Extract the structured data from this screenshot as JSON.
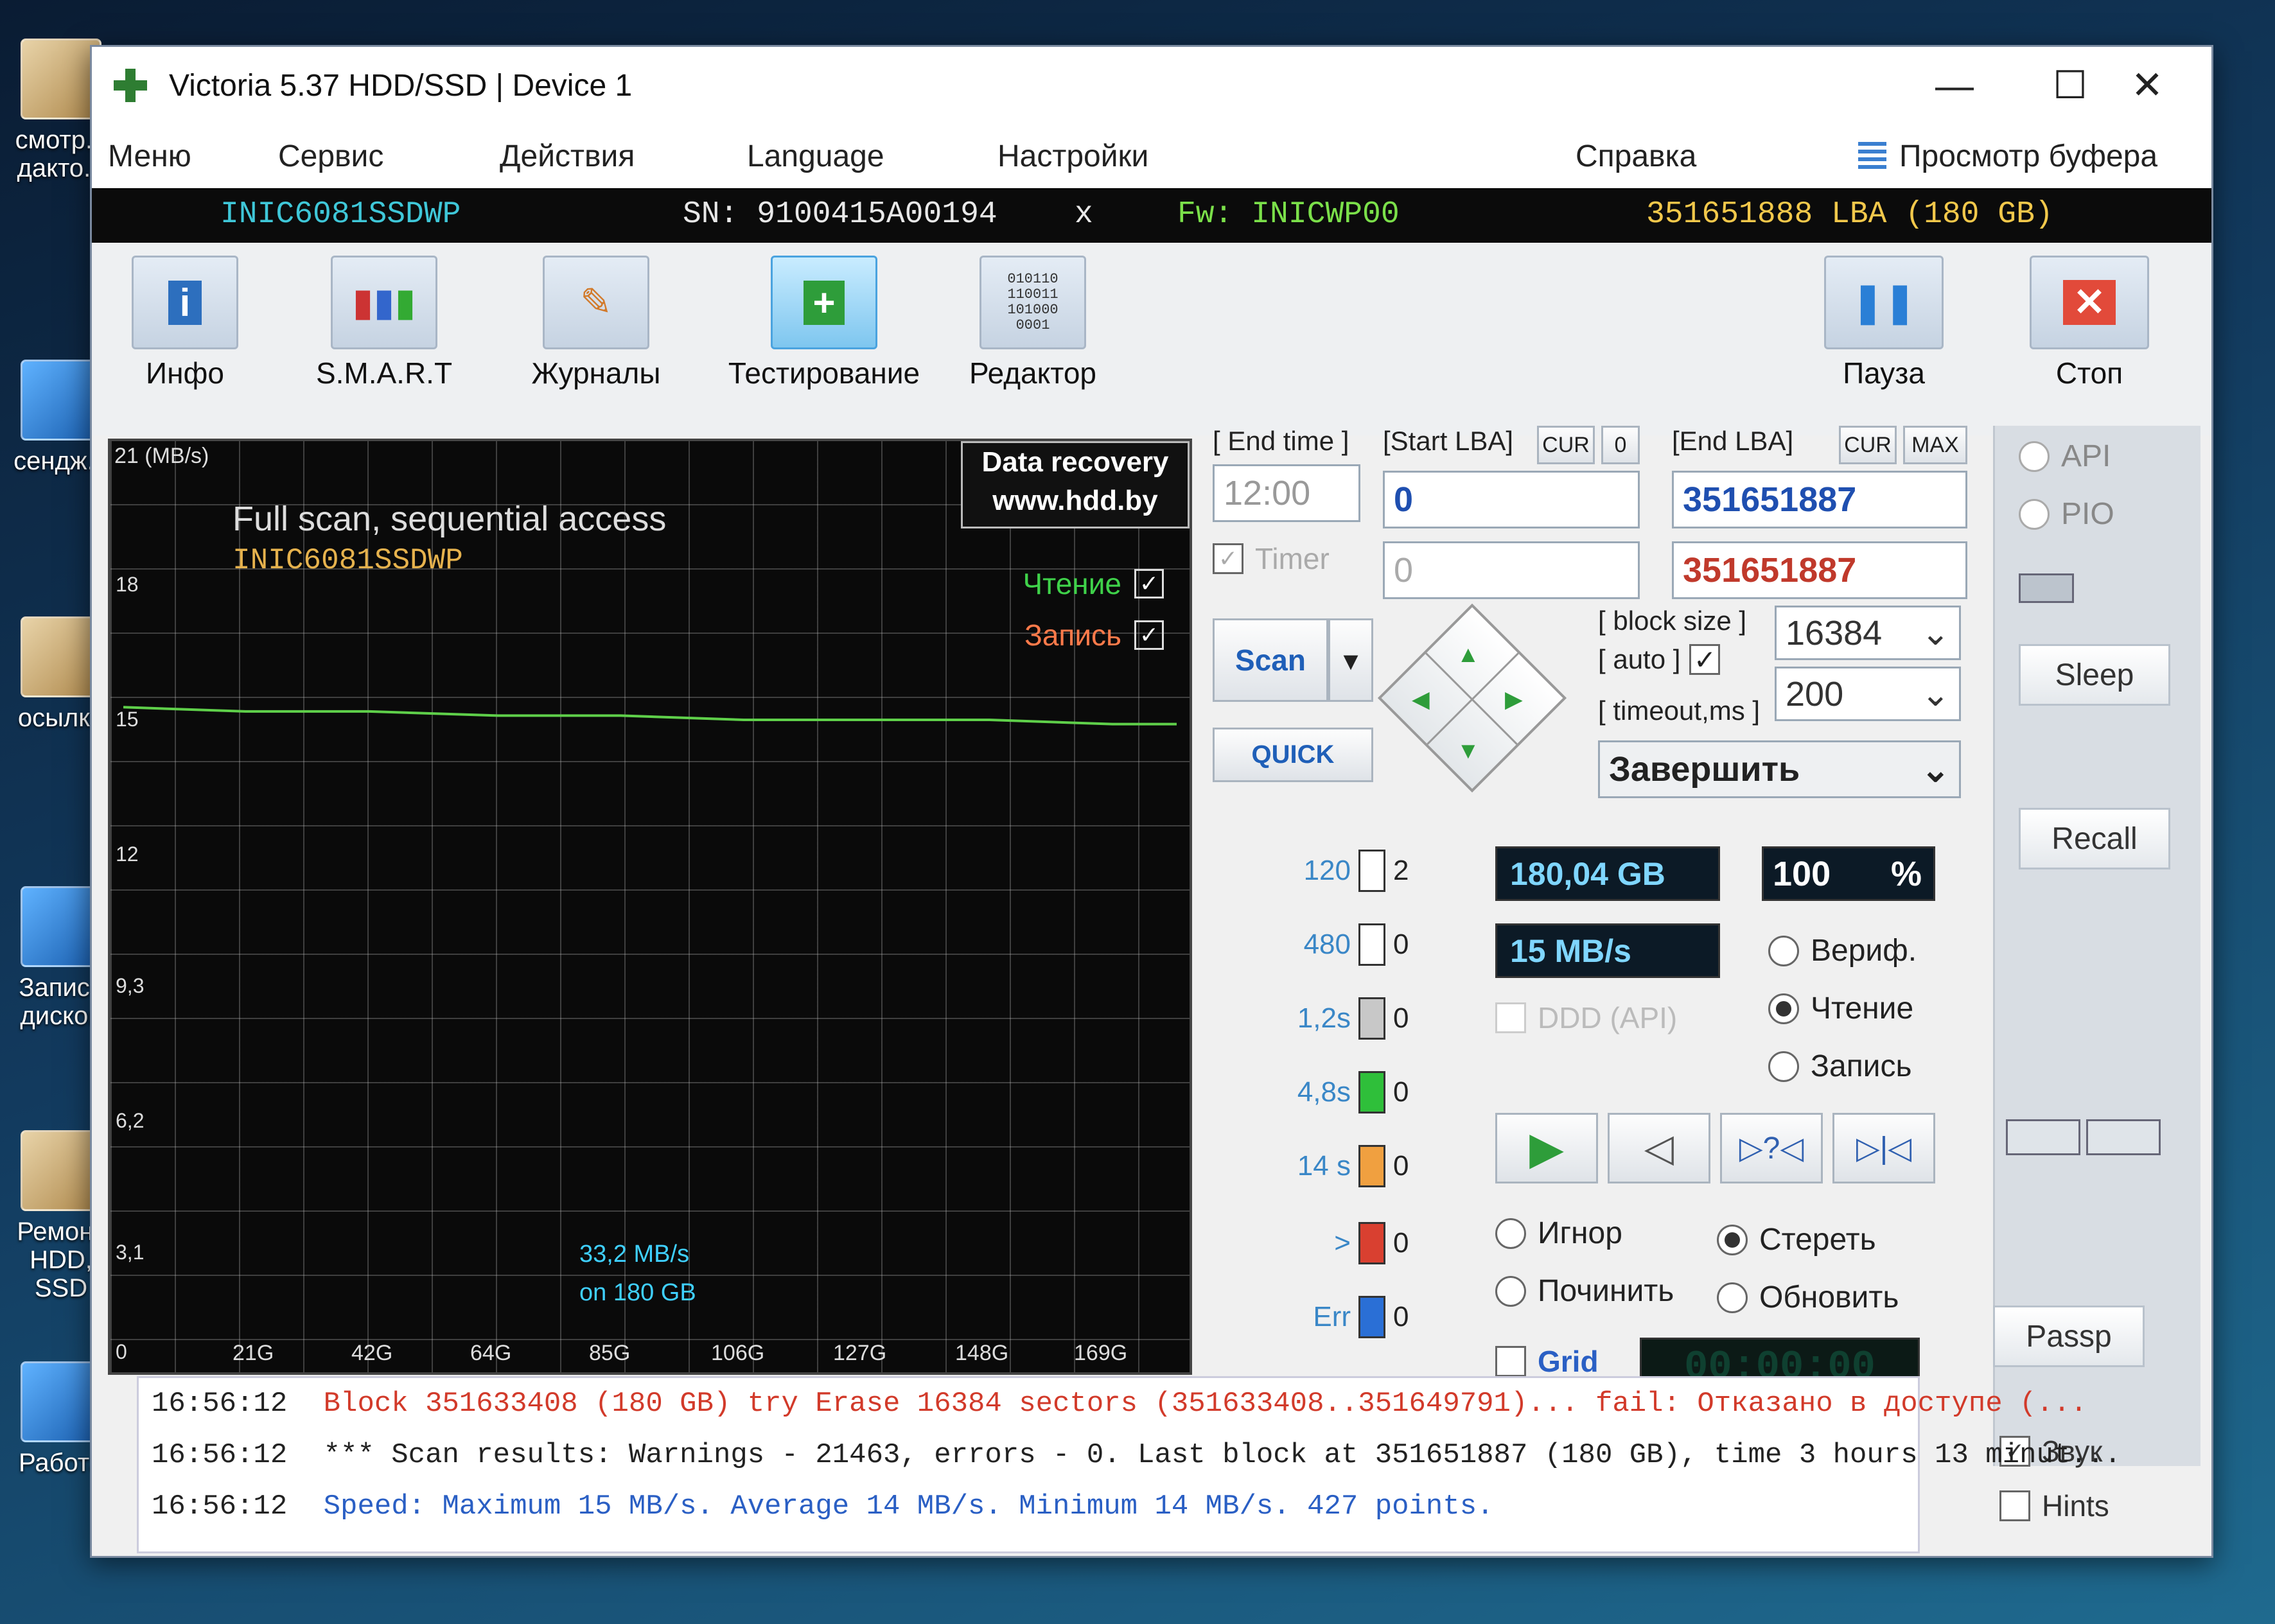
{
  "desktop": {
    "icons": [
      {
        "label": "смотр... дакто..."
      },
      {
        "label": "сендж..."
      },
      {
        "label": "осылки"
      },
      {
        "label": "Запись дисков"
      },
      {
        "label": "Ремонт HDD, SSD"
      },
      {
        "label": "Работа"
      }
    ]
  },
  "window": {
    "title": "Victoria 5.37 HDD/SSD | Device 1",
    "minimize": "—",
    "maximize": "☐",
    "close": "✕"
  },
  "menu": {
    "items": [
      "Меню",
      "Сервис",
      "Действия",
      "Language",
      "Настройки",
      "Справка"
    ],
    "buffer_view": "Просмотр буфера"
  },
  "device": {
    "model": "INIC6081SSDWP",
    "serial": "SN: 9100415A00194",
    "x": "x",
    "firmware": "Fw: INICWP00",
    "capacity": "351651888 LBA (180 GB)"
  },
  "toolbar": {
    "tools": [
      {
        "label": "Инфо",
        "icon": "info-icon"
      },
      {
        "label": "S.M.A.R.T",
        "icon": "smart-icon"
      },
      {
        "label": "Журналы",
        "icon": "logs-icon"
      },
      {
        "label": "Тестирование",
        "icon": "test-icon"
      },
      {
        "label": "Редактор",
        "icon": "editor-icon"
      }
    ],
    "pause": "Пауза",
    "stop": "Стоп"
  },
  "graph": {
    "unit": "21 (MB/s)",
    "title": "Full scan, sequential access",
    "device": "INIC6081SSDWP",
    "promo_line1": "Data recovery",
    "promo_line2": "www.hdd.by",
    "read_label": "Чтение",
    "write_label": "Запись",
    "yticks": [
      "18",
      "15",
      "12",
      "9,3",
      "6,2",
      "3,1",
      "0"
    ],
    "xticks": [
      "21G",
      "42G",
      "64G",
      "85G",
      "106G",
      "127G",
      "148G",
      "169G"
    ],
    "speed_line1": "33,2 MB/s",
    "speed_line2": "on 180 GB"
  },
  "chart_data": {
    "type": "line",
    "title": "Full scan, sequential access",
    "ylabel": "(MB/s)",
    "ylim": [
      0,
      21
    ],
    "xlabel": "",
    "x": [
      0,
      21,
      42,
      64,
      85,
      106,
      127,
      148,
      169,
      180
    ],
    "series": [
      {
        "name": "Чтение",
        "values": [
          15.0,
          14.9,
          14.9,
          14.8,
          14.8,
          14.7,
          14.7,
          14.7,
          14.6,
          14.6
        ]
      }
    ]
  },
  "controls": {
    "end_time_label": "[ End time ]",
    "end_time_value": "12:00",
    "timer_label": "Timer",
    "start_lba_label": "[Start LBA]",
    "cur": "CUR",
    "zero": "0",
    "end_lba_label": "[End LBA]",
    "max": "MAX",
    "start_lba_value": "0",
    "start_lba_value2": "0",
    "end_lba_value": "351651887",
    "end_lba_value2": "351651887",
    "block_size_label": "[ block size ]",
    "auto_label": "[ auto ]",
    "timeout_label": "[ timeout,ms ]",
    "block_size_value": "16384",
    "timeout_value": "200",
    "finish_value": "Завершить",
    "scan_button": "Scan",
    "quick_button": "QUICK",
    "api": "API",
    "pio": "PIO",
    "sleep": "Sleep",
    "recall": "Recall",
    "passp": "Passp"
  },
  "legend": [
    {
      "label": "120",
      "count": "2",
      "color": "#ffffff"
    },
    {
      "label": "480",
      "count": "0",
      "color": "#ffffff"
    },
    {
      "label": "1,2s",
      "count": "0",
      "color": "#c8c8c8"
    },
    {
      "label": "4,8s",
      "count": "0",
      "color": "#2fbf3a"
    },
    {
      "label": "14 s",
      "count": "0",
      "color": "#f0a040"
    },
    {
      "label": ">",
      "count": "0",
      "color": "#d94030"
    },
    {
      "label": "Err",
      "count": "0",
      "color": "#2a6fd6"
    }
  ],
  "stats": {
    "size": "180,04 GB",
    "percent": "100",
    "percent_sign": "%",
    "speed": "15 MB/s",
    "ddd": "DDD (API)",
    "verify": "Вериф.",
    "read": "Чтение",
    "write": "Запись",
    "ignore": "Игнор",
    "erase": "Стереть",
    "fix": "Починить",
    "refresh": "Обновить",
    "grid": "Grid",
    "timer_display": "00:00:00"
  },
  "log": [
    {
      "time": "16:56:12",
      "text": "Block 351633408 (180 GB) try Erase 16384 sectors (351633408..351649791)... fail: Отказано в доступе (...",
      "color": "#d23a2a"
    },
    {
      "time": "16:56:12",
      "text": "*** Scan results: Warnings - 21463, errors - 0. Last block at 351651887 (180 GB), time 3 hours 13 minut...",
      "color": "#222222"
    },
    {
      "time": "16:56:12",
      "text": "Speed: Maximum 15 MB/s. Average 14 MB/s. Minimum 14 MB/s. 427 points.",
      "color": "#2a5fc4"
    }
  ],
  "options": {
    "sound": "Звук",
    "hints": "Hints"
  }
}
